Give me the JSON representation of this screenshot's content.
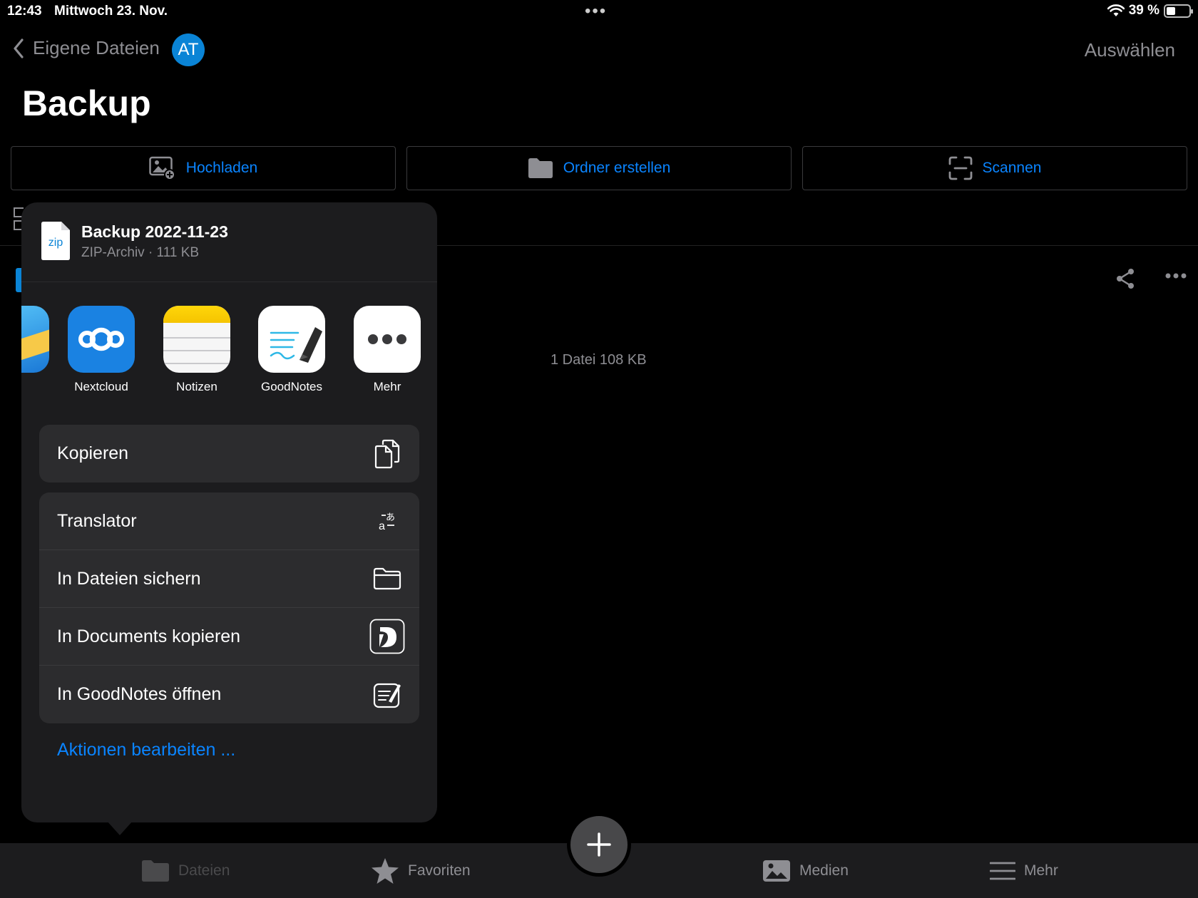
{
  "status_bar": {
    "time": "12:43",
    "date": "Mittwoch 23. Nov.",
    "battery": "39 %",
    "battery_fraction": 0.39
  },
  "nav": {
    "back_label": "Eigene Dateien",
    "avatar_initials": "AT",
    "select_label": "Auswählen"
  },
  "page": {
    "title": "Backup"
  },
  "actions": {
    "upload": "Hochladen",
    "create_folder": "Ordner erstellen",
    "scan": "Scannen"
  },
  "content": {
    "file_count": "1 Datei 108 KB"
  },
  "share_sheet": {
    "file_name": "Backup 2022-11-23",
    "file_meta": "ZIP-Archiv · 111 KB",
    "file_type_label": "zip",
    "apps": [
      {
        "label": "Nextcloud",
        "icon": "nextcloud-icon"
      },
      {
        "label": "Notizen",
        "icon": "notes-icon"
      },
      {
        "label": "GoodNotes",
        "icon": "goodnotes-icon"
      },
      {
        "label": "Mehr",
        "icon": "more-icon"
      }
    ],
    "copy": {
      "label": "Kopieren",
      "icon": "copy-icon"
    },
    "actions": [
      {
        "label": "Translator",
        "icon": "translate-icon"
      },
      {
        "label": "In Dateien sichern",
        "icon": "folder-icon"
      },
      {
        "label": "In Documents kopieren",
        "icon": "documents-app-icon"
      },
      {
        "label": "In GoodNotes öffnen",
        "icon": "goodnotes-open-icon"
      }
    ],
    "edit_actions": "Aktionen bearbeiten ..."
  },
  "tab_bar": {
    "files": "Dateien",
    "favorites": "Favoriten",
    "media": "Medien",
    "more": "Mehr"
  },
  "colors": {
    "accent": "#0a84ff",
    "background": "#000000",
    "sheet": "#1c1c1e",
    "group": "#2c2c2e"
  }
}
